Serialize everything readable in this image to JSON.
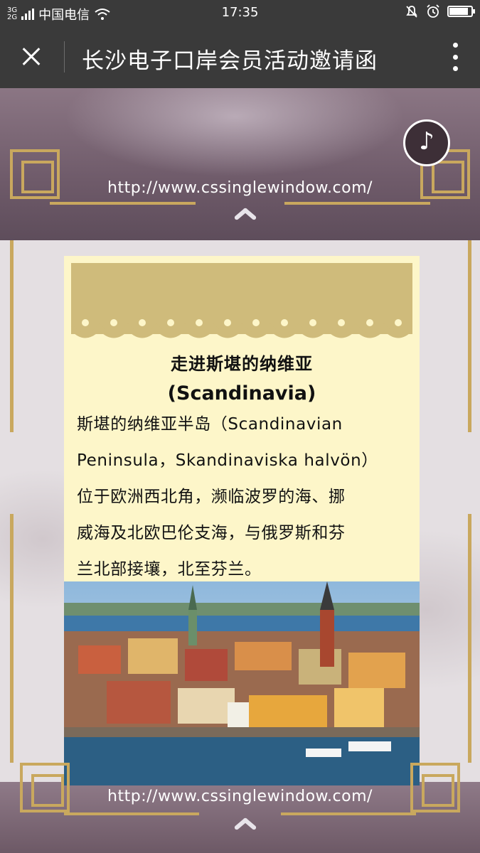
{
  "status_bar": {
    "network": "3G 2G",
    "carrier": "中国电信",
    "time": "17:35",
    "battery_level": 0.85
  },
  "title_bar": {
    "title": "长沙电子口岸会员活动邀请函"
  },
  "previous_page": {
    "url": "http://www.cssinglewindow.com/"
  },
  "card": {
    "title": "走进斯堪的纳维亚",
    "subtitle": "(Scandinavia)",
    "body_lines": [
      "斯堪的纳维亚半岛（Scandinavian",
      "Peninsula，Skandinaviska halvön）",
      "位于欧洲西北角，濒临波罗的海、挪",
      "威海及北欧巴伦支海，与俄罗斯和芬",
      "兰北部接壤，北至芬兰。"
    ]
  },
  "footer": {
    "url": "http://www.cssinglewindow.com/"
  },
  "colors": {
    "gold": "#c9a85e",
    "card_bg": "#fdf6c9",
    "bar_bg": "#3a3a3a"
  }
}
